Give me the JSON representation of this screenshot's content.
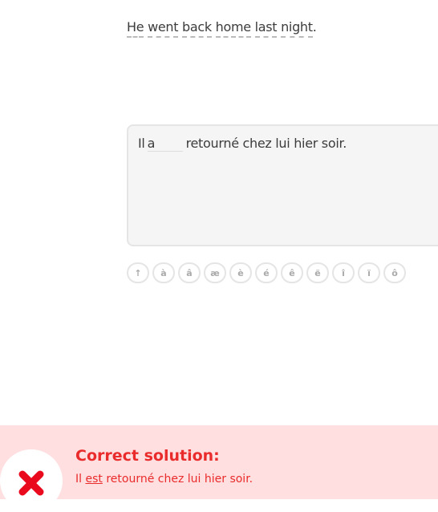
{
  "prompt": {
    "words": [
      "He",
      "went",
      "back",
      "home",
      "last",
      "night"
    ],
    "end": "."
  },
  "answer": {
    "before": "Il",
    "typed": "a",
    "after": "retourné chez lui hier soir."
  },
  "keyboard": [
    "↑",
    "à",
    "â",
    "æ",
    "è",
    "é",
    "ê",
    "ë",
    "î",
    "ï",
    "ô"
  ],
  "feedback": {
    "title": "Correct solution:",
    "before": "Il",
    "highlight": "est",
    "after": "retourné chez lui hier soir.",
    "color": "#ea2b2b"
  }
}
